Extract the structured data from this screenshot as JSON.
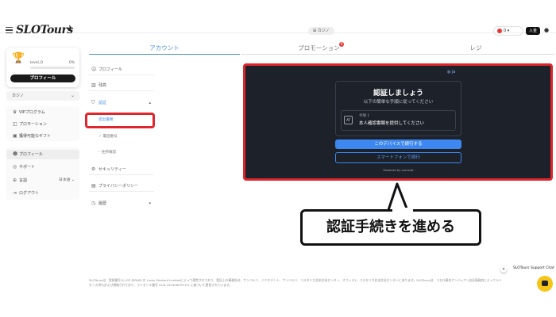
{
  "header": {
    "logo": "SLOTours",
    "casino_pill": "カジノ",
    "balance": "0",
    "deposit_label": "入金"
  },
  "tabs": [
    "アカウント",
    "プロモーション",
    "レジ"
  ],
  "promo_badge": "6",
  "profile_card": {
    "level": "level_0",
    "progress": "0%",
    "progress_fraction": 0,
    "button": "プロフィール"
  },
  "sidebar": {
    "casino_select": "カジノ",
    "items": [
      "VIPプログラム",
      "プロモーション",
      "獲得可能なギフト",
      "プロフィール",
      "サポート",
      "言語",
      "ログアウト"
    ],
    "language_value": "日本語"
  },
  "account_menu": {
    "profile": "プロフィール",
    "limits": "残高",
    "verification": "認証",
    "sub_docs": "提出書類",
    "sub_phone": "電話番号",
    "sub_address": "住所確認",
    "security": "セキュリティー",
    "privacy": "プライバシーポリシー",
    "history": "履歴"
  },
  "verify": {
    "lang": "Ja",
    "title": "認証しましょう",
    "subtitle": "以下の簡単な手順に従ってください",
    "step_label": "手順 1",
    "step_text": "本人確認書類を提供してください",
    "step_icon": "AT",
    "continue_btn": "このデバイスで続行する",
    "phone_btn": "スマートフォンで続行",
    "powered": "Powered by  sumsub"
  },
  "annotation": "認証手続きを進める",
  "footer": "SLOToursは、登録番号 8-103 @RNSI の Lucky Mustard Limitedによって運営されており、登記上の事務所は、サンベルリ、ハツオデント、サンベルリ、コスタリカ北米文化センター、オフィス1、コスタリカ北米文化センターにあります。SLOToursは、コモロ連合アンジュアン自治島政府によってライセンス供与および規制されており、ライセンス番号 ALSI-192406033-FI1 に基づいて運営されています。",
  "chat": {
    "label": "SLOTours Support Chat",
    "close": "×"
  }
}
